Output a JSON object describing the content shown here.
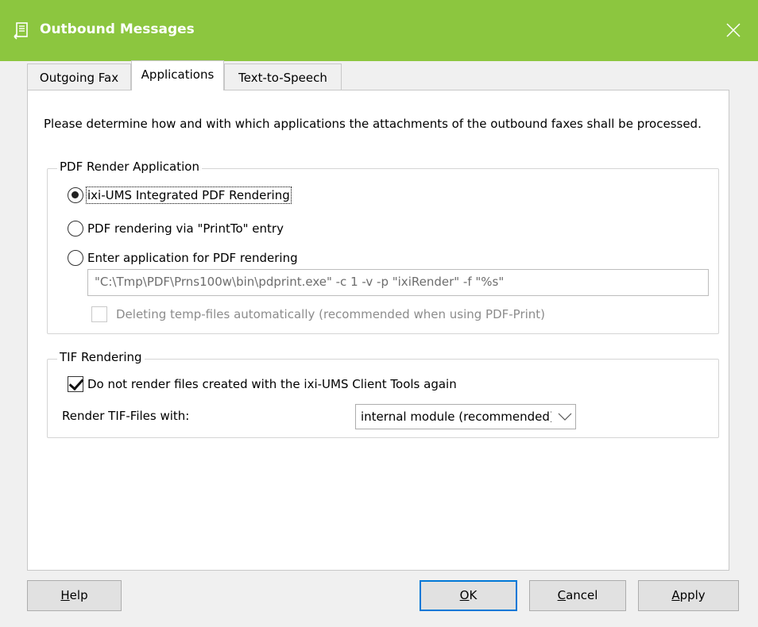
{
  "window": {
    "title": "Outbound Messages",
    "icon": "document-arrow-icon",
    "accent_color": "#8cc63f"
  },
  "tabs": [
    {
      "label": "Outgoing Fax",
      "active": false
    },
    {
      "label": "Applications",
      "active": true
    },
    {
      "label": "Text-to-Speech",
      "active": false
    }
  ],
  "description": "Please determine how and with which applications the attachments of the outbound faxes shall be processed.",
  "pdf_group": {
    "legend": "PDF Render Application",
    "options": [
      {
        "label": "ixi-UMS Integrated PDF Rendering",
        "checked": true
      },
      {
        "label": "PDF rendering via \"PrintTo\" entry",
        "checked": false
      },
      {
        "label": "Enter application for PDF rendering",
        "checked": false
      }
    ],
    "command_value": "\"C:\\Tmp\\PDF\\Prns100w\\bin\\pdprint.exe\" -c 1 -v -p \"ixiRender\" -f \"%s\"",
    "delete_temp_label": "Deleting temp-files automatically (recommended when using PDF-Print)",
    "delete_temp_checked": false
  },
  "tif_group": {
    "legend": "TIF Rendering",
    "no_render_label": "Do not render files created with the ixi-UMS Client Tools again",
    "no_render_checked": true,
    "render_with_label": "Render TIF-Files with:",
    "render_with_value": "internal module (recommended)"
  },
  "buttons": {
    "help": {
      "pre": "",
      "key": "H",
      "post": "elp"
    },
    "ok": {
      "pre": "",
      "key": "O",
      "post": "K"
    },
    "cancel": {
      "pre": "",
      "key": "C",
      "post": "ancel"
    },
    "apply": {
      "pre": "",
      "key": "A",
      "post": "pply"
    }
  }
}
